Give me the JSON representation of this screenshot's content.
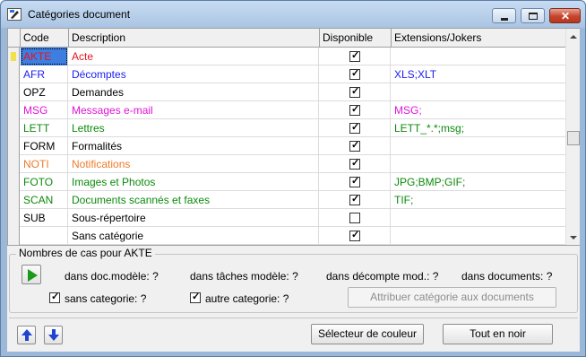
{
  "window": {
    "title": "Catégories document"
  },
  "grid": {
    "columns": [
      "Code",
      "Description",
      "Disponible",
      "Extensions/Jokers"
    ],
    "rows": [
      {
        "code": "AKTE",
        "description": "Acte",
        "disponible": "☑",
        "extensions": "",
        "color": "#e8141e",
        "selected": true
      },
      {
        "code": "AFR",
        "description": "Décomptes",
        "disponible": "☑",
        "extensions": "XLS;XLT",
        "color": "#1d1df0"
      },
      {
        "code": "OPZ",
        "description": "Demandes",
        "disponible": "☑",
        "extensions": "",
        "color": "#000000"
      },
      {
        "code": "MSG",
        "description": "Messages e-mail",
        "disponible": "☑",
        "extensions": "MSG;",
        "color": "#e014d8"
      },
      {
        "code": "LETT",
        "description": "Lettres",
        "disponible": "☑",
        "extensions": "LETT_*.*;msg;",
        "color": "#0c8a0c"
      },
      {
        "code": "FORM",
        "description": "Formalités",
        "disponible": "☑",
        "extensions": "",
        "color": "#000000"
      },
      {
        "code": "NOTI",
        "description": "Notifications",
        "disponible": "☑",
        "extensions": "",
        "color": "#f07a28"
      },
      {
        "code": "FOTO",
        "description": "Images et Photos",
        "disponible": "☑",
        "extensions": "JPG;BMP;GIF;",
        "color": "#0c8a0c"
      },
      {
        "code": "SCAN",
        "description": "Documents scannés et faxes",
        "disponible": "☑",
        "extensions": "TIF;",
        "color": "#0c8a0c"
      },
      {
        "code": "SUB",
        "description": "Sous-répertoire",
        "disponible": "☐",
        "extensions": "",
        "color": "#000000"
      },
      {
        "code": "",
        "description": "Sans catégorie",
        "disponible": "☑",
        "extensions": "",
        "color": "#000000"
      }
    ]
  },
  "group": {
    "title": "Nombres de cas pour AKTE",
    "stats": [
      "dans doc.modèle: ?",
      "dans tâches modèle: ?",
      "dans décompte mod.: ?",
      "dans documents: ?"
    ],
    "sans_categorie": {
      "label": "sans categorie: ?",
      "checked": "☑"
    },
    "autre_categorie": {
      "label": "autre categorie: ?",
      "checked": "☑"
    },
    "assign_button": "Attribuer catégorie aux documents"
  },
  "footer": {
    "color_selector": "Sélecteur de couleur",
    "all_black": "Tout en noir"
  }
}
